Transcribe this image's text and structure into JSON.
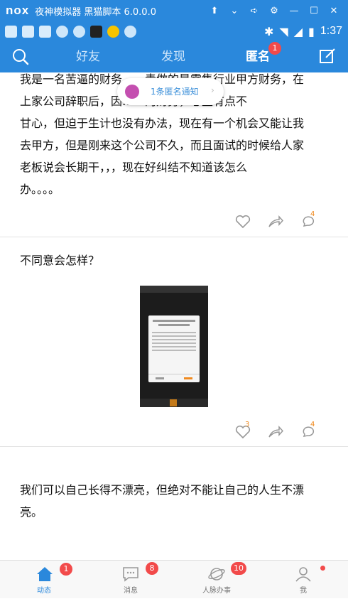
{
  "emulator": {
    "logo": "nox",
    "title": "夜神模拟器 黑猫脚本 6.0.0.0"
  },
  "status_bar": {
    "time": "1:37"
  },
  "nav": {
    "tabs": [
      {
        "label": "好友"
      },
      {
        "label": "发现"
      },
      {
        "label": "匿名",
        "active": true
      }
    ],
    "badge": "1"
  },
  "toast": {
    "text": "1条匿名通知"
  },
  "posts": [
    {
      "text_lines": [
        "我是一名苦逼的财务……青做的是零售行业甲方财务，在",
        "上家公司辞职后，因……的财务，心里有点不",
        "甘心，但迫于生计也没有办法，现在有一个机会又能让我",
        "去甲方，但是刚来这个公司不久，而且面试的时候给人家",
        "老板说会长期干，，，现在好纠结不知道该怎么",
        "办。。。。"
      ],
      "like_count": "",
      "comment_count": "4"
    },
    {
      "text_lines": [
        "不同意会怎样？"
      ],
      "like_count": "3",
      "comment_count": "4"
    },
    {
      "text_lines": [
        "我们可以自己长得不漂亮，但绝对不能让自己的人生不漂",
        "亮。"
      ]
    }
  ],
  "tab_bar": {
    "tabs": [
      {
        "label": "动态",
        "badge": "1",
        "active": true
      },
      {
        "label": "消息",
        "badge": "8"
      },
      {
        "label": "人脉办事",
        "badge": "10"
      },
      {
        "label": "我",
        "dot": true
      }
    ]
  },
  "colors": {
    "primary": "#2a88dc",
    "badge": "#f24a4a",
    "count": "#f08a1f"
  }
}
